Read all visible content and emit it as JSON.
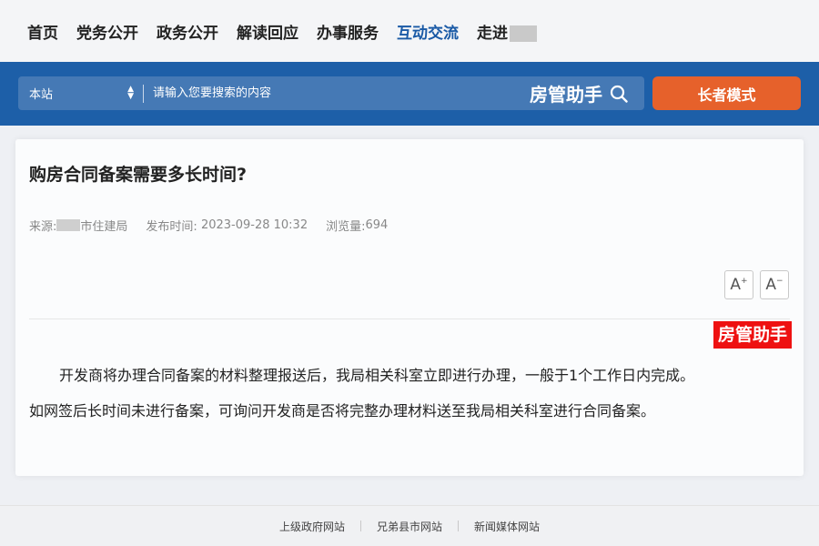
{
  "nav": {
    "items": [
      {
        "label": "首页"
      },
      {
        "label": "党务公开"
      },
      {
        "label": "政务公开"
      },
      {
        "label": "解读回应"
      },
      {
        "label": "办事服务"
      },
      {
        "label": "互动交流",
        "active": true
      },
      {
        "label": "走进"
      }
    ]
  },
  "search": {
    "scope": "本站",
    "placeholder": "请输入您要搜索的内容",
    "brand": "房管助手"
  },
  "elder_mode_label": "长者模式",
  "article": {
    "title": "购房合同备案需要多长时间?",
    "source_label": "来源:",
    "source_suffix": "市住建局",
    "publish_label": "发布时间:",
    "publish_time": "2023-09-28 10:32",
    "views_label": "浏览量:",
    "views": "694",
    "font_up": "A",
    "font_up_sup": "+",
    "font_down": "A",
    "font_down_sup": "−",
    "stamp": "房管助手",
    "paragraph1": "开发商将办理合同备案的材料整理报送后，我局相关科室立即进行办理，一般于1个工作日内完成。",
    "paragraph2": "如网签后长时间未进行备案，可询问开发商是否将完整办理材料送至我局相关科室进行合同备案。"
  },
  "footer": {
    "links": [
      "上级政府网站",
      "兄弟县市网站",
      "新闻媒体网站"
    ]
  },
  "colors": {
    "brand_blue": "#1d5fa8",
    "active_nav": "#1a5aa6",
    "elder_button": "#e6612b",
    "stamp_red": "#ee1111"
  }
}
